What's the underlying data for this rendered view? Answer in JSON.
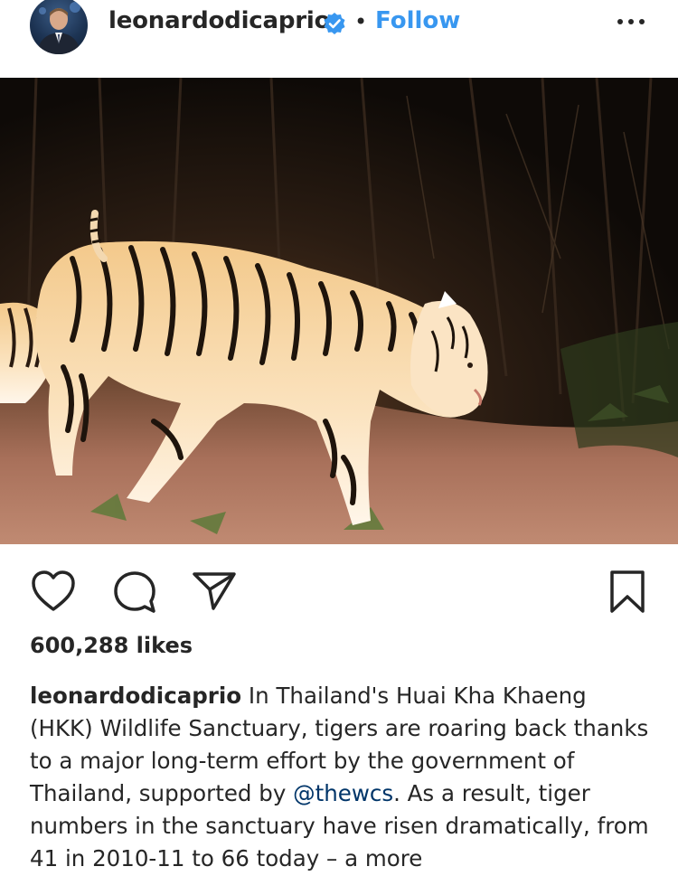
{
  "header": {
    "username": "leonardodicaprio",
    "separator": "•",
    "follow_label": "Follow",
    "verified_icon": "verified-badge-icon",
    "more_icon": "more-options-icon",
    "accent_color": "#3897f0"
  },
  "post": {
    "image_alt": "",
    "likes_text": "600,288 likes",
    "caption": {
      "username": "leonardodicaprio",
      "text_before_mention": " In Thailand's Huai Kha Khaeng (HKK) Wildlife Sanctuary, tigers are roaring back thanks to a major long-term effort by the government of Thailand, supported by ",
      "mention": "@thewcs",
      "text_after_mention": ". As a result, tiger numbers in the sanctuary have risen dramatically, from 41 in 2010-11 to 66 today – a more"
    }
  },
  "actions": {
    "like_icon": "heart-icon",
    "comment_icon": "comment-icon",
    "share_icon": "share-icon",
    "save_icon": "bookmark-icon"
  }
}
